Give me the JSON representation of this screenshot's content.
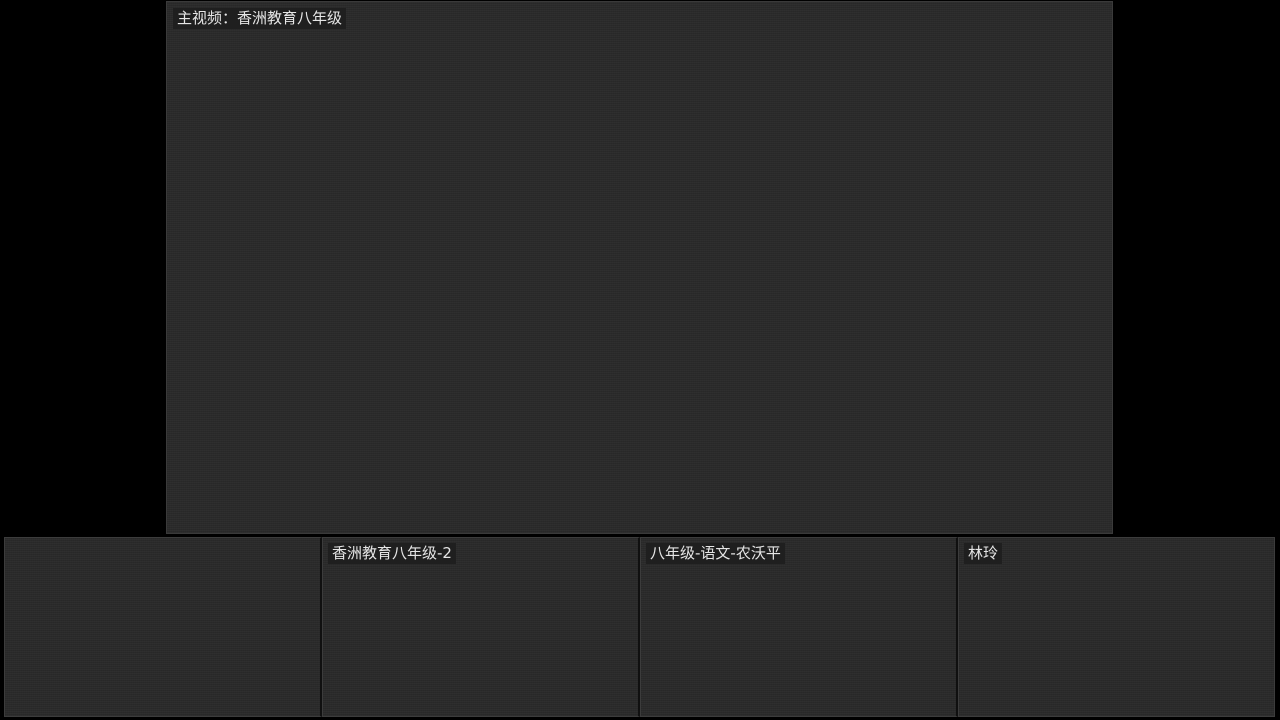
{
  "main_video": {
    "label": "主视频：香洲教育八年级"
  },
  "tiles": [
    {
      "label": ""
    },
    {
      "label": "香洲教育八年级-2"
    },
    {
      "label": "八年级-语文-农沃平"
    },
    {
      "label": "林玲"
    }
  ],
  "colors": {
    "background": "#000000",
    "panel": "#2a2a2a",
    "label_text": "#e6e6e6",
    "label_bg": "#1f1f1f"
  }
}
